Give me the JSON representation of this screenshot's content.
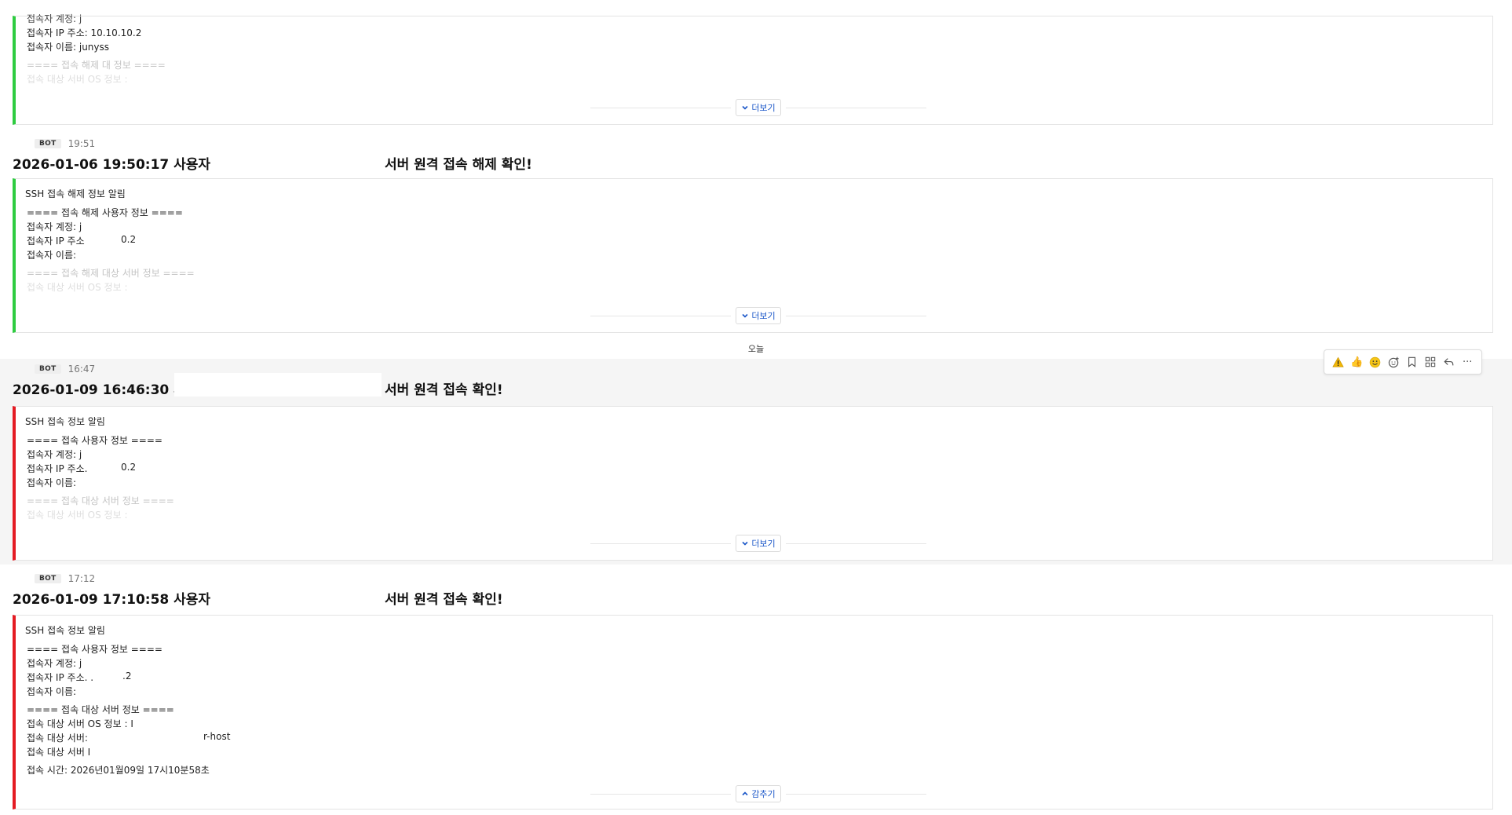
{
  "messages": [
    {
      "card": {
        "lines": [
          "접속자 계정: j",
          "접속자 IP 주소: 10.10.10.2",
          "접속자 이름: junyss"
        ],
        "faded_lines": [
          "==== 접속 해제 대            정보 ====",
          "접속 대상 서버 OS 정보 :"
        ],
        "toggle_label": "더보기"
      }
    },
    {
      "bot_badge": "BOT",
      "time": "19:51",
      "title_left": "2026-01-06 19:50:17 사용자",
      "title_right": "서버 원격 접속 해제 확인!",
      "card": {
        "header": "SSH 접속 해제 정보 알림",
        "lines": [
          "==== 접속 해제 사용자 정보 ====",
          "접속자 계정: j",
          "접속자 IP 주소",
          "0.2",
          "접속자 이름:"
        ],
        "faded_lines": [
          "==== 접속 해제 대상 서버 정보 ====",
          "접속 대상 서버 OS 정보 :"
        ],
        "toggle_label": "더보기"
      }
    },
    {
      "bot_badge": "BOT",
      "time": "16:47",
      "title_left": "2026-01-09 16:46:30 사용자",
      "title_right": "서버 원격 접속 확인!",
      "card": {
        "header": "SSH 접속 정보 알림",
        "lines": [
          "==== 접속 사용자 정보 ====",
          "접속자 계정: j",
          "접속자 IP 주소.",
          "0.2",
          "접속자 이름:"
        ],
        "faded_lines": [
          "==== 접속 대상 서버 정보 ====",
          "접속 대상 서버 OS 정보 :"
        ],
        "toggle_label": "더보기"
      }
    },
    {
      "bot_badge": "BOT",
      "time": "17:12",
      "title_left": "2026-01-09 17:10:58 사용자",
      "title_right": "서버 원격 접속 확인!",
      "card": {
        "header": "SSH 접속 정보 알림",
        "lines": [
          "==== 접속 사용자 정보 ====",
          "접속자 계정: j",
          "접속자 IP 주소. .",
          ".2",
          "접속자 이름:",
          "==== 접속 대상 서버 정보 ====",
          "접속 대상 서버 OS 정보 : I",
          "접속 대상 서버:",
          "r-host",
          "접속 대상 서버 I",
          "접속 시간: 2026년01월09일 17시10분58초"
        ],
        "toggle_label": "감추기"
      }
    }
  ],
  "date_divider": "오늘",
  "hover_toolbar": {
    "icons": [
      "warning-icon",
      "thumbs-up-icon",
      "smile-icon",
      "add-reaction-icon",
      "bookmark-icon",
      "apps-icon",
      "reply-icon",
      "more-icon"
    ],
    "glyphs": [
      "⚠",
      "👍",
      "😄",
      "☺",
      "",
      "",
      "↶",
      "···"
    ]
  },
  "colors": {
    "resolved_border": "#2ecc40",
    "alert_border": "#e41b23",
    "link": "#1a56c8"
  }
}
